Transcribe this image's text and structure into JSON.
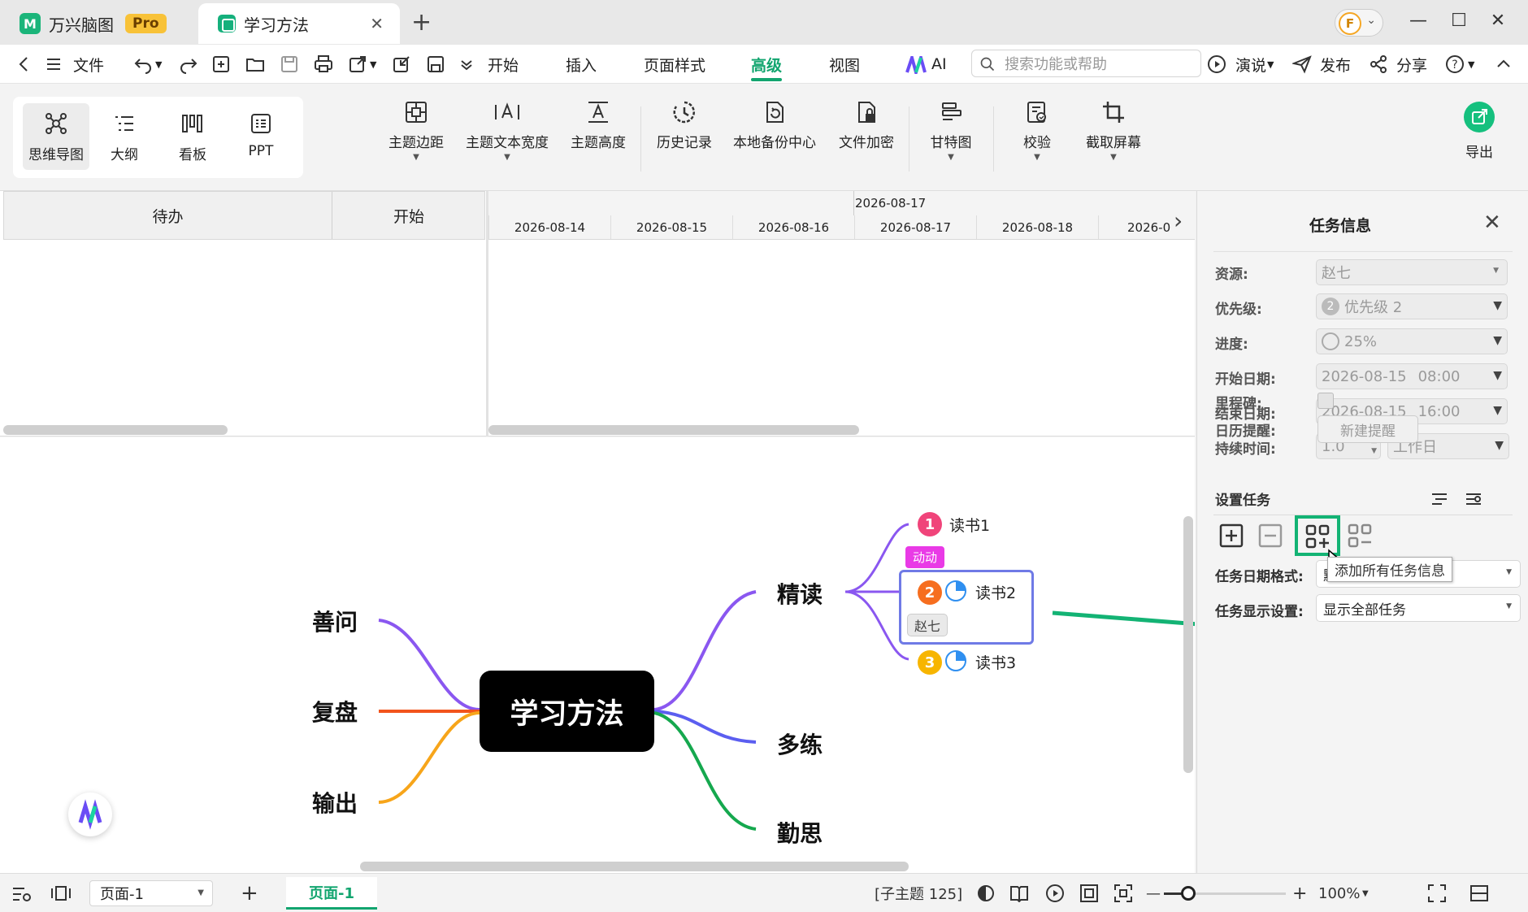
{
  "titlebar": {
    "app_tab": {
      "logo": "M",
      "label": "万兴脑图",
      "badge": "Pro"
    },
    "doc_tab": {
      "label": "学习方法",
      "close": "✕"
    },
    "new_tab": "+",
    "avatar_letter": "F",
    "avatar_chevron": "⌄",
    "window_controls": {
      "minimize": "—",
      "maximize": "☐",
      "close": "✕"
    }
  },
  "menubar": {
    "file": "文件",
    "tabs": [
      "开始",
      "插入",
      "页面样式",
      "高级",
      "视图"
    ],
    "active_tab": "高级",
    "ai": "AI",
    "search_placeholder": "搜索功能或帮助",
    "present": "演说",
    "publish": "发布",
    "share": "分享",
    "help_icon": "?"
  },
  "ribbon": {
    "views": [
      "思维导图",
      "大纲",
      "看板",
      "PPT"
    ],
    "active_view": "思维导图",
    "tools": [
      {
        "label": "主题边距",
        "has_dropdown": true
      },
      {
        "label": "主题文本宽度",
        "has_dropdown": true
      },
      {
        "label": "主题高度",
        "has_dropdown": false
      },
      {
        "label": "历史记录",
        "has_dropdown": false
      },
      {
        "label": "本地备份中心",
        "has_dropdown": false
      },
      {
        "label": "文件加密",
        "has_dropdown": false
      },
      {
        "label": "甘特图",
        "has_dropdown": true
      },
      {
        "label": "校验",
        "has_dropdown": true
      },
      {
        "label": "截取屏幕",
        "has_dropdown": true
      }
    ],
    "export": "导出"
  },
  "gantt": {
    "columns": [
      "待办",
      "开始"
    ],
    "timeline_top": "2026-08-17",
    "dates": [
      "2026-08-14",
      "2026-08-15",
      "2026-08-16",
      "2026-08-17",
      "2026-08-18",
      "2026-0"
    ],
    "next_arrow": "›"
  },
  "mindmap": {
    "central": "学习方法",
    "left_branches": [
      "善问",
      "复盘",
      "输出"
    ],
    "right_branches": [
      "精读",
      "多练",
      "勤思"
    ],
    "subtopics": [
      {
        "num": "1",
        "label": "读书1",
        "color": "#f0447a",
        "progress": null
      },
      {
        "num": "2",
        "label": "读书2",
        "color": "#f66e1f",
        "progress": 0.25
      },
      {
        "num": "3",
        "label": "读书3",
        "color": "#f7b500",
        "progress": 0.25
      }
    ],
    "tag": "动动",
    "resource_chip": "赵七",
    "branch_colors": {
      "善问": "#8a57f0",
      "复盘": "#f2541c",
      "输出": "#f7a51a",
      "精读": "#8a57f0",
      "多练": "#5b5ef0",
      "勤思": "#15a84e"
    },
    "annotation_arrow_color": "#13b374"
  },
  "task_panel": {
    "title": "任务信息",
    "close": "✕",
    "fields": {
      "resource": {
        "label": "资源:",
        "value": "赵七"
      },
      "priority": {
        "label": "优先级:",
        "num": "2",
        "value": "优先级 2"
      },
      "progress": {
        "label": "进度:",
        "value": "25%"
      },
      "start_date": {
        "label": "开始日期:",
        "date": "2026-08-15",
        "time": "08:00"
      },
      "end_date": {
        "label": "结束日期:",
        "date": "2026-08-15",
        "time": "16:00"
      },
      "duration": {
        "label": "持续时间:",
        "value": "1.0",
        "unit": "工作日"
      },
      "milestone": {
        "label": "里程碑:",
        "checked": false
      },
      "reminder": {
        "label": "日历提醒:",
        "button": "新建提醒"
      }
    },
    "set_task": {
      "title": "设置任务",
      "tooltip": "添加所有任务信息",
      "date_format_label": "任务日期格式:",
      "date_format_value": "默认",
      "display_label": "任务显示设置:",
      "display_value": "显示全部任务"
    }
  },
  "statusbar": {
    "page_select": "页面-1",
    "add_page": "+",
    "page_tab": "页面-1",
    "subtopic_count": "[子主题 125]",
    "zoom_minus": "—",
    "zoom_plus": "+",
    "zoom_value": "100%",
    "zoom_level": 0.2
  }
}
